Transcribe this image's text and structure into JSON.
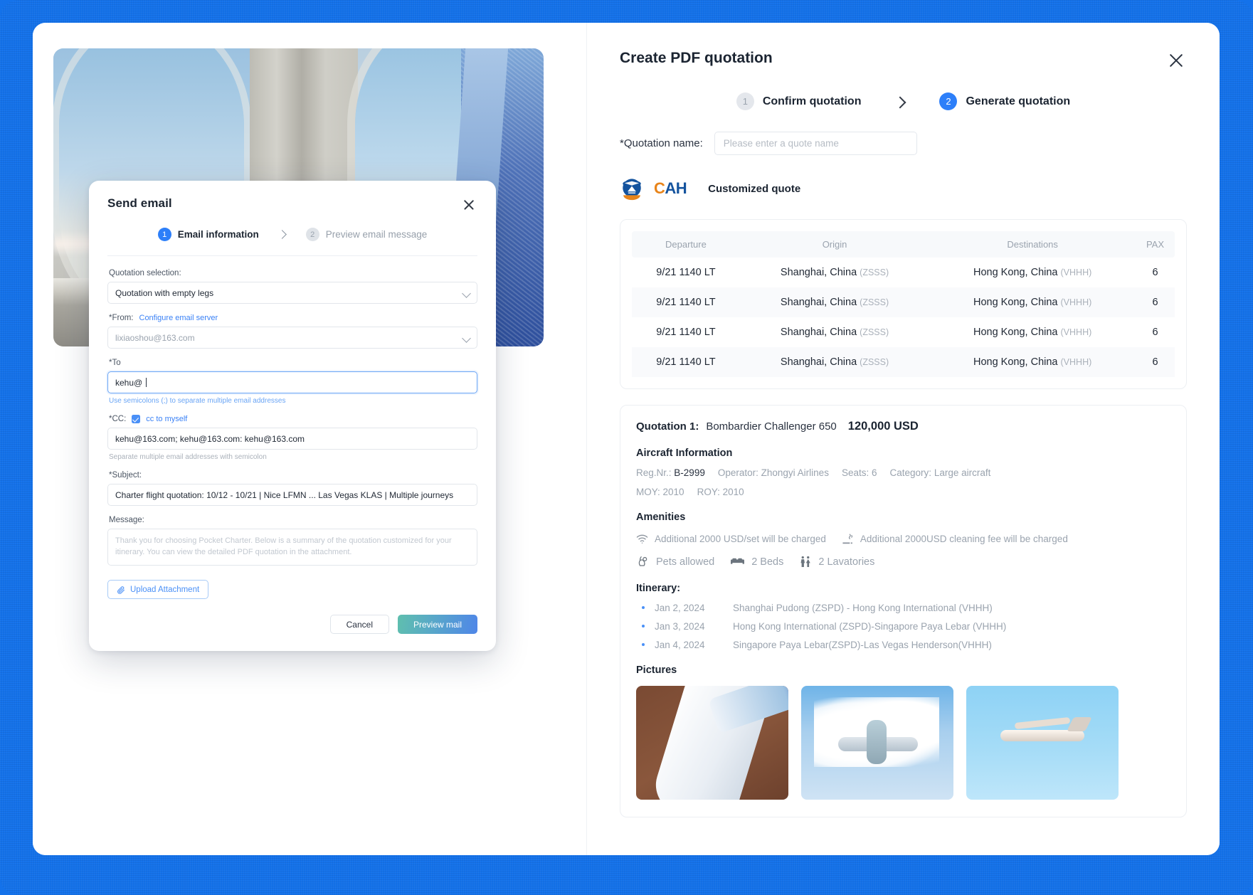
{
  "modal": {
    "title": "Send email",
    "close_icon": "close-icon",
    "steps": [
      {
        "num": "1",
        "label": "Email information",
        "state": "active"
      },
      {
        "num": "2",
        "label": "Preview email message",
        "state": "idle"
      }
    ],
    "quotation_selection_label": "Quotation selection:",
    "quotation_selection_value": "Quotation with empty legs",
    "from_label": "*From:",
    "from_link": "Configure email server",
    "from_value": "lixiaoshou@163.com",
    "to_label": "*To",
    "to_value": "kehu@",
    "to_hint": "Use semicolons (;) to separate multiple email addresses",
    "cc_label": "*CC:",
    "cc_checkbox_label": "cc to myself",
    "cc_value": "kehu@163.com; kehu@163.com: kehu@163.com",
    "cc_hint": "Separate multiple email addresses with semicolon",
    "subject_label": "*Subject:",
    "subject_value": "Charter flight quotation: 10/12 - 10/21 | Nice LFMN ... Las Vegas KLAS | Multiple journeys",
    "message_label": "Message:",
    "message_placeholder": "Thank you for choosing Pocket Charter. Below is a summary of the quotation customized for your itinerary. You can view the detailed PDF quotation in the attachment.",
    "upload_label": "Upload Attachment",
    "cancel_label": "Cancel",
    "primary_label": "Preview mail"
  },
  "panel": {
    "title": "Create PDF quotation",
    "close_icon": "close-icon",
    "steps": [
      {
        "num": "1",
        "label": "Confirm quotation",
        "state": "idle"
      },
      {
        "num": "2",
        "label": "Generate quotation",
        "state": "active"
      }
    ],
    "quotation_name_label": "*Quotation name:",
    "quotation_name_placeholder": "Please enter a quote name",
    "brand_c": "C",
    "brand_ah": "AH",
    "brand_caption": "Customized quote",
    "table": {
      "headers": [
        "Departure",
        "Origin",
        "Destinations",
        "PAX"
      ],
      "rows": [
        {
          "departure": "9/21 1140 LT",
          "origin": "Shanghai, China",
          "origin_code": "(ZSSS)",
          "destination": "Hong Kong, China",
          "destination_code": "(VHHH)",
          "pax": "6"
        },
        {
          "departure": "9/21 1140 LT",
          "origin": "Shanghai, China",
          "origin_code": "(ZSSS)",
          "destination": "Hong Kong, China",
          "destination_code": "(VHHH)",
          "pax": "6"
        },
        {
          "departure": "9/21 1140 LT",
          "origin": "Shanghai, China",
          "origin_code": "(ZSSS)",
          "destination": "Hong Kong, China",
          "destination_code": "(VHHH)",
          "pax": "6"
        },
        {
          "departure": "9/21 1140 LT",
          "origin": "Shanghai, China",
          "origin_code": "(ZSSS)",
          "destination": "Hong Kong, China",
          "destination_code": "(VHHH)",
          "pax": "6"
        }
      ]
    },
    "quotation": {
      "key": "Quotation 1:",
      "aircraft": "Bombardier Challenger 650",
      "price": "120,000 USD",
      "aircraft_info_title": "Aircraft Information",
      "reg_label": "Reg.Nr.:",
      "reg_value": "B-2999",
      "operator_label": "Operator:",
      "operator_value": "Zhongyi Airlines",
      "seats_label": "Seats:",
      "seats_value": "6",
      "category_label": "Category:",
      "category_value": "Large aircraft",
      "moy_label": "MOY:",
      "moy_value": "2010",
      "roy_label": "ROY:",
      "roy_value": "2010",
      "amenities_title": "Amenities",
      "amenities": [
        {
          "icon": "wifi-icon",
          "text": "Additional 2000 USD/set will be charged"
        },
        {
          "icon": "smoking-icon",
          "text": "Additional 2000USD cleaning fee will be charged"
        },
        {
          "icon": "pet-icon",
          "text": "Pets allowed"
        },
        {
          "icon": "bed-icon",
          "text": "2 Beds"
        },
        {
          "icon": "lavatory-icon",
          "text": "2 Lavatories"
        }
      ],
      "itinerary_title": "Itinerary:",
      "itinerary": [
        {
          "date": "Jan 2, 2024",
          "route": "Shanghai Pudong (ZSPD) - Hong Kong International (VHHH)"
        },
        {
          "date": "Jan 3, 2024",
          "route": "Hong Kong International (ZSPD)-Singapore Paya Lebar (VHHH)"
        },
        {
          "date": "Jan 4, 2024",
          "route": "Singapore Paya Lebar(ZSPD)-Las Vegas Henderson(VHHH)"
        }
      ],
      "pictures_title": "Pictures",
      "pictures": [
        "airplane-wing-photo",
        "airplane-landing-photo",
        "private-jet-photo"
      ]
    }
  },
  "colors": {
    "accent": "#2d7ff9",
    "frame": "#1472ea",
    "brand_orange": "#e8841a",
    "brand_blue": "#14539e"
  }
}
